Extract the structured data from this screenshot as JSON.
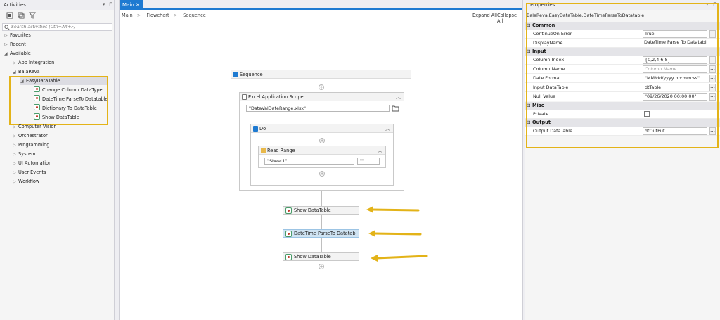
{
  "activities": {
    "title": "Activities",
    "search_placeholder": "Search activities (Ctrl+Alt+F)",
    "tree": {
      "favorites": "Favorites",
      "recent": "Recent",
      "available": "Available",
      "app_integration": "App Integration",
      "balareva": "BalaReva",
      "easy_data_table": "EasyDataTable",
      "items": [
        "Change Column DataType",
        "DateTime ParseTo Datatable",
        "Dictionary To DataTable",
        "Show DataTable"
      ],
      "others": [
        "Computer Vision",
        "Orchestrator",
        "Programming",
        "System",
        "UI Automation",
        "User Events",
        "Workflow"
      ]
    }
  },
  "designer": {
    "tab": "Main",
    "breadcrumb": [
      "Main",
      "Flowchart",
      "Sequence"
    ],
    "expand_all": "Expand All",
    "collapse_all": "Collapse All",
    "sequence_title": "Sequence",
    "excel_scope_title": "Excel Application Scope",
    "excel_file": "\"DataValDateRange.xlsx\"",
    "do_title": "Do",
    "read_range_title": "Read Range",
    "sheet_value": "\"Sheet1\"",
    "range_value": "\"\"",
    "activities": [
      "Show DataTable",
      "DateTime ParseTo Datatabl",
      "Show DataTable"
    ]
  },
  "properties": {
    "title": "Properties",
    "type_name": "BalaReva.EasyDataTable.DateTimeParseToDatatable",
    "sections": {
      "common": "Common",
      "input": "Input",
      "misc": "Misc",
      "output": "Output"
    },
    "rows": {
      "continue_on_error": {
        "name": "ContinueOn Error",
        "value": "True"
      },
      "display_name": {
        "name": "DisplayName",
        "value": "DateTime Parse To Datatable"
      },
      "column_index": {
        "name": "Column Index",
        "value": "{0,2,4,6,8}"
      },
      "column_name": {
        "name": "Column Name",
        "placeholder": "Column Name"
      },
      "date_format": {
        "name": "Date Format",
        "value": "\"MM/dd/yyyy hh:mm:ss\""
      },
      "input_datatable": {
        "name": "Input DataTable",
        "value": "dtTable"
      },
      "null_value": {
        "name": "Null Value",
        "value": "\"09/26/2020 00:00:00\""
      },
      "private": {
        "name": "Private"
      },
      "output_datatable": {
        "name": "Output DataTable",
        "value": "dtOutPut"
      }
    }
  },
  "colors": {
    "accent": "#1e7ad1",
    "highlight": "#e3b318"
  }
}
